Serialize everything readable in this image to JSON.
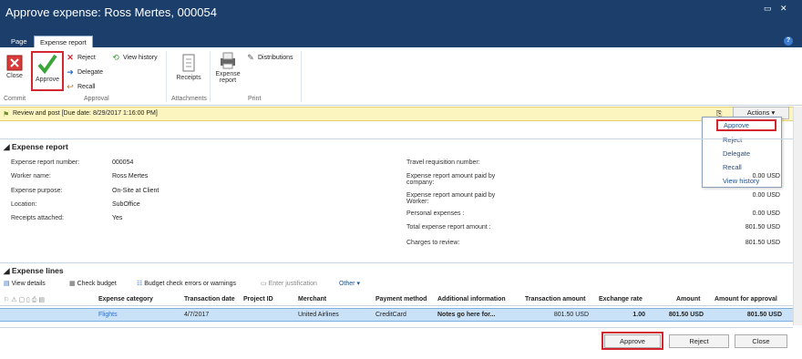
{
  "window": {
    "title": "Approve expense: Ross Mertes, 000054"
  },
  "tabs": [
    {
      "label": "Page"
    },
    {
      "label": "Expense report"
    }
  ],
  "ribbon": {
    "close": "Close",
    "approve": "Approve",
    "reject": "Reject",
    "delegate": "Delegate",
    "recall": "Recall",
    "view_history": "View history",
    "receipts": "Receipts",
    "expense_report": "Expense report",
    "distributions": "Distributions",
    "groups": {
      "commit": "Commit",
      "approval": "Approval",
      "attachments": "Attachments",
      "print": "Print"
    }
  },
  "banner": {
    "text": "Review and post [Due date: 8/29/2017 1:16:00 PM]"
  },
  "actions": {
    "label": "Actions",
    "items": [
      "Approve",
      "Reject",
      "Delegate",
      "Recall",
      "View history"
    ]
  },
  "expense_report": {
    "header": "Expense report",
    "left": [
      {
        "label": "Expense report number:",
        "value": "000054"
      },
      {
        "label": "Worker name:",
        "value": "Ross Mertes"
      },
      {
        "label": "Expense purpose:",
        "value": "On-Site at Client"
      },
      {
        "label": "Location:",
        "value": "SubOffice"
      },
      {
        "label": "Receipts attached:",
        "value": "Yes"
      }
    ],
    "right": [
      {
        "label": "Travel requisition number:",
        "value": ""
      },
      {
        "label": "Expense report amount paid by company:",
        "value": "0.00 USD"
      },
      {
        "label": "Expense report amount paid by Worker:",
        "value": "0.00 USD"
      },
      {
        "label": "Personal expenses :",
        "value": "0.00 USD"
      },
      {
        "label": "Total expense report amount :",
        "value": "801.50 USD"
      },
      {
        "label": "Charges to review:",
        "value": "801.50 USD"
      }
    ]
  },
  "expense_lines": {
    "header": "Expense lines",
    "toolbar": {
      "view_details": "View details",
      "check_budget": "Check budget",
      "budget_errors": "Budget check errors or warnings",
      "enter_justification": "Enter justification",
      "other": "Other"
    },
    "columns": [
      "Expense category",
      "Transaction date",
      "Project ID",
      "Merchant",
      "Payment method",
      "Additional information",
      "Transaction amount",
      "Exchange rate",
      "Amount",
      "Amount for approval"
    ],
    "rows": [
      {
        "category": "Flights",
        "date": "4/7/2017",
        "project": "",
        "merchant": "United Airlines",
        "payment": "CreditCard",
        "info": "Notes go here for...",
        "trans_amount": "801.50 USD",
        "rate": "1.00",
        "amount": "801.50 USD",
        "approval_amount": "801.50 USD"
      }
    ]
  },
  "footer": {
    "approve": "Approve",
    "reject": "Reject",
    "close": "Close"
  }
}
